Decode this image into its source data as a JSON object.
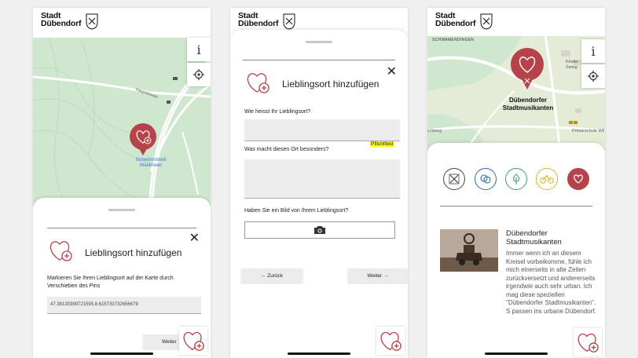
{
  "brand": {
    "line1": "Stadt",
    "line2": "Dübendorf"
  },
  "colors": {
    "accent": "#b5434b",
    "map_green": "#cfe6cf",
    "highlight": "#ffff00"
  },
  "screen1": {
    "info_label": "i",
    "locate_icon": "crosshair-icon",
    "map_place": "Schwimmbreiti\nWaldmeier",
    "sheet_title": "Lieblingsort hinzufügen",
    "instruction": "Markieren Sie Ihren Lieblingsort auf der Karte durch Verschieben des Pins",
    "coords_value": "47.38130399721595,8.615733732656679",
    "next_label": "Weiter"
  },
  "screen2": {
    "sheet_title": "Lieblingsort hinzufügen",
    "q_name": "Wie heisst Ihr Lieblingsort?",
    "required": "Pflichtfeld",
    "q_special": "Was macht diesen Ort besonders?",
    "q_photo": "Haben Sie ein Bild von Ihrem Lieblingsort?",
    "back_label": "← Zurück",
    "next_label": "Weiter →"
  },
  "screen3": {
    "info_label": "i",
    "map_area": "SCHWAMENDINGEN",
    "map_kinder": "Kinder\nZwing",
    "map_school": "Primarschule Wil",
    "map_aich": "ichberg",
    "pin_label": "Dübendorfer\nStadtmusikanten",
    "poi_title": "Dübendorfer\nStadtmusikanten",
    "poi_text": "Immer wenn ich an diesem Kreisel vorbeikomme, fühle ich mich einerseits in alte Zeiten zurückversetzt und andererseits irgendwie auch sehr urban. Ich mag diese speziellen \"Dübendorfer Stadtmusikanten\". S passen ins urbane Dübendorf.",
    "categories": [
      "crest",
      "theater",
      "nature",
      "bike",
      "heart"
    ]
  }
}
